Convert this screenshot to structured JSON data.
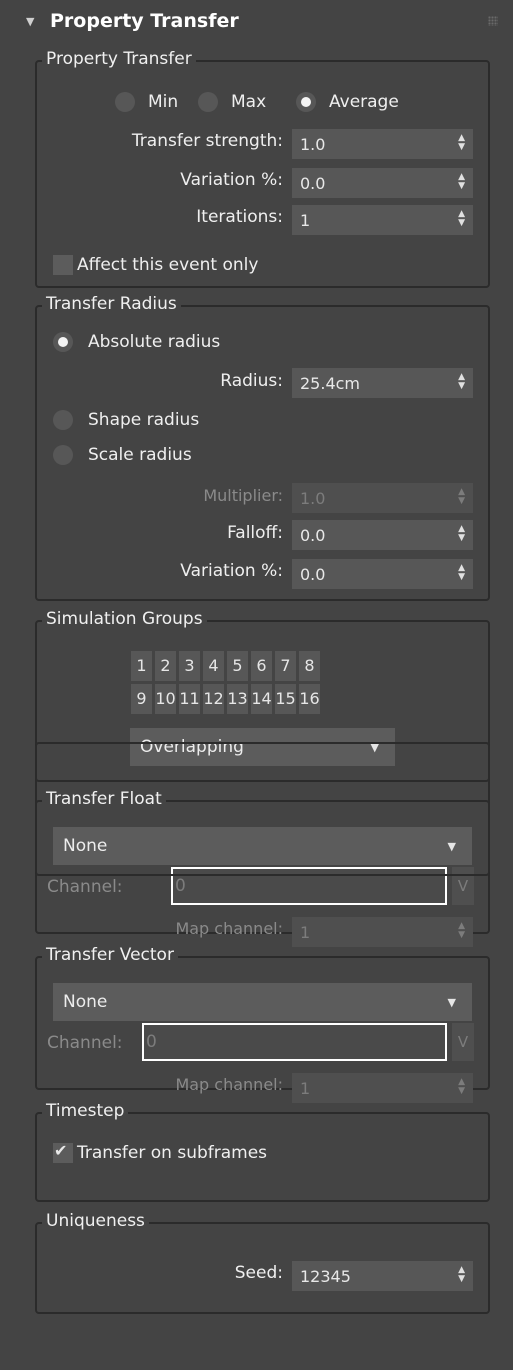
{
  "header": {
    "arrow": "▼",
    "title": "Property Transfer"
  },
  "property_transfer": {
    "legend": "Property Transfer",
    "modes": [
      "Min",
      "Max",
      "Average"
    ],
    "strength_label": "Transfer strength:",
    "strength_value": "1.0",
    "variation_label": "Variation %:",
    "variation_value": "0.0",
    "iterations_label": "Iterations:",
    "iterations_value": "1",
    "affect_label": "Affect this event only"
  },
  "transfer_radius": {
    "legend": "Transfer Radius",
    "absolute_label": "Absolute radius",
    "radius_label": "Radius:",
    "radius_value": "25.4cm",
    "shape_label": "Shape radius",
    "scale_label": "Scale radius",
    "multiplier_label": "Multiplier:",
    "multiplier_value": "1.0",
    "falloff_label": "Falloff:",
    "falloff_value": "0.0",
    "variation_label": "Variation %:",
    "variation_value": "0.0"
  },
  "simulation_groups": {
    "legend": "Simulation Groups",
    "row1": [
      "1",
      "2",
      "3",
      "4",
      "5",
      "6",
      "7",
      "8"
    ],
    "row2": [
      "9",
      "10",
      "11",
      "12",
      "13",
      "14",
      "15",
      "16"
    ],
    "mode_value": "Overlapping"
  },
  "transfer_float": {
    "legend": "Transfer Float",
    "dropdown_value": "None",
    "channel_label": "Channel:",
    "channel_value": "0",
    "v_label": "V",
    "map_label": "Map channel:",
    "map_value": "1"
  },
  "transfer_vector": {
    "legend": "Transfer Vector",
    "dropdown_value": "None",
    "channel_label": "Channel:",
    "channel_value": "0",
    "v_label": "V",
    "map_label": "Map channel:",
    "map_value": "1"
  },
  "timestep": {
    "legend": "Timestep",
    "subframes_label": "Transfer on subframes"
  },
  "uniqueness": {
    "legend": "Uniqueness",
    "seed_label": "Seed:",
    "seed_value": "12345"
  },
  "icons": {
    "spinner": "spinner-arrows-icon",
    "dropdown": "chevron-down-icon",
    "grip": "grip-dots-icon"
  }
}
